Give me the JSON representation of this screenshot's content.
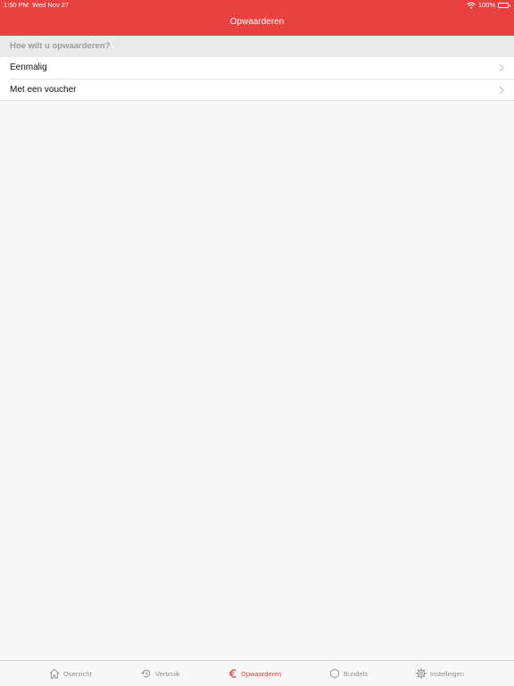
{
  "status_bar": {
    "time": "1:50 PM",
    "date": "Wed Nov 27",
    "battery": "100%",
    "battery_level": 1.0
  },
  "nav": {
    "title": "Opwaarderen"
  },
  "section": {
    "header": "Hoe wilt u opwaarderen?"
  },
  "list": {
    "items": [
      {
        "label": "Eenmalig"
      },
      {
        "label": "Met een voucher"
      }
    ]
  },
  "tabbar": {
    "active_color": "#e9413f",
    "inactive_color": "#8e8e8e",
    "tabs": [
      {
        "label": "Overzicht",
        "icon": "home-icon"
      },
      {
        "label": "Verbruik",
        "icon": "history-icon"
      },
      {
        "label": "Opwaarderen",
        "icon": "euro-icon",
        "active": true
      },
      {
        "label": "Bundels",
        "icon": "hexagon-icon"
      },
      {
        "label": "Instellingen",
        "icon": "gear-icon"
      }
    ]
  },
  "colors": {
    "brand": "#e9413f",
    "background": "#f7f7f7",
    "section_header_bg": "#ebebeb"
  }
}
